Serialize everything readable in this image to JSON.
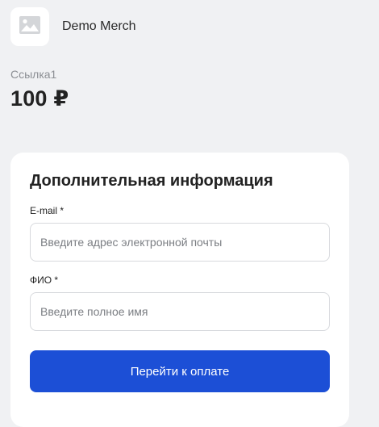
{
  "merchant": {
    "name": "Demo Merch",
    "logo_icon": "image-placeholder-icon"
  },
  "payment": {
    "link_name": "Ссылка1",
    "amount": "100 ₽"
  },
  "form": {
    "title": "Дополнительная информация",
    "email": {
      "label": "E-mail *",
      "placeholder": "Введите адрес электронной почты",
      "value": ""
    },
    "fio": {
      "label": "ФИО *",
      "placeholder": "Введите полное имя",
      "value": ""
    },
    "submit_label": "Перейти к оплате"
  },
  "colors": {
    "background": "#f0f1f3",
    "card": "#ffffff",
    "accent": "#1c4fd6",
    "muted_text": "#8c8f94"
  }
}
